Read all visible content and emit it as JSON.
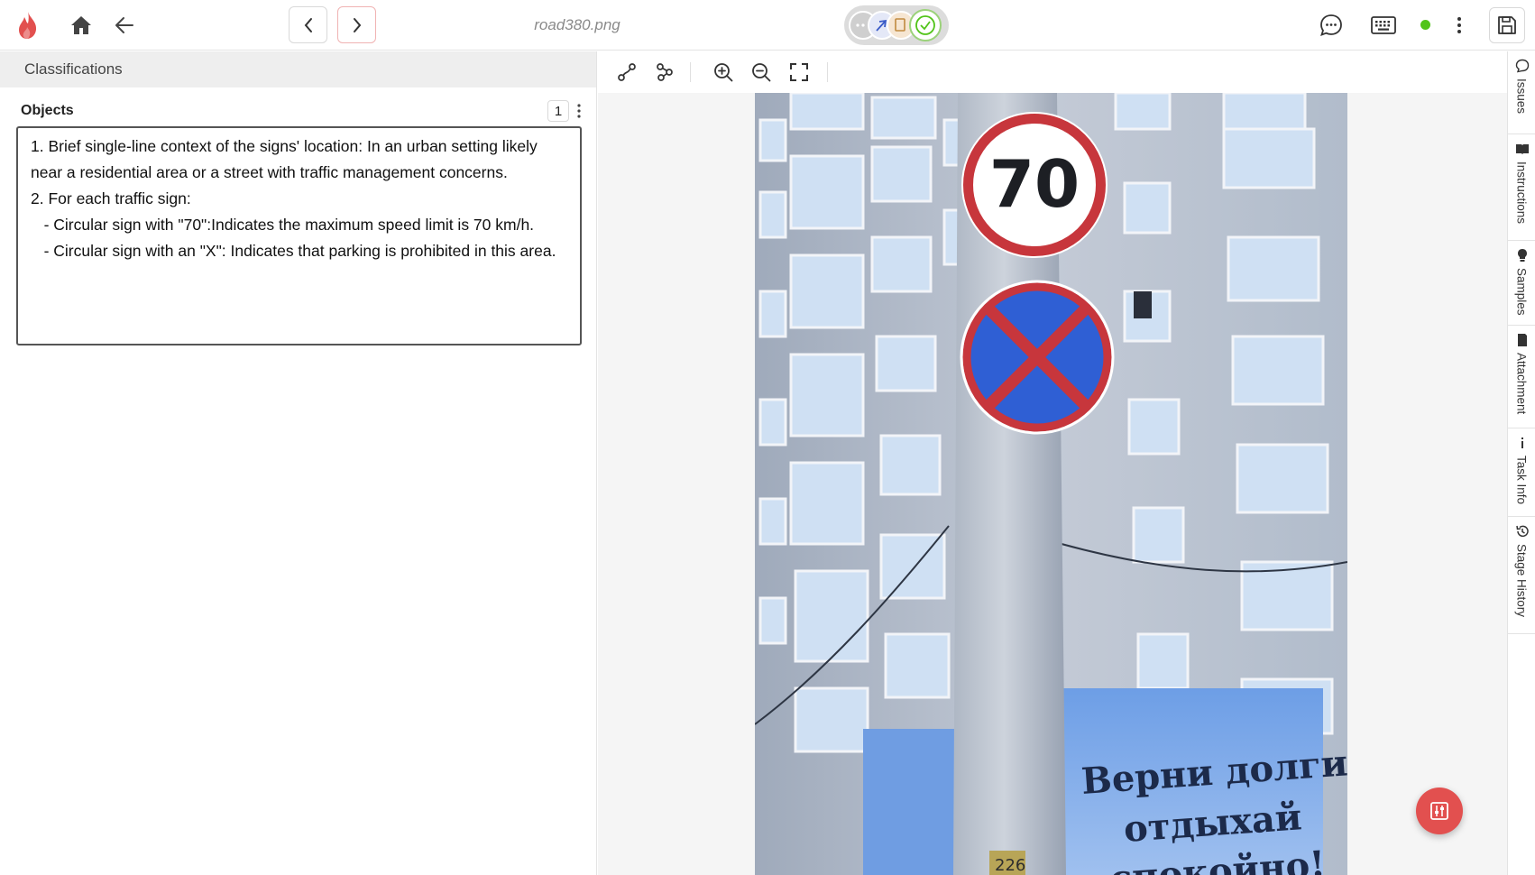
{
  "app": {
    "filename": "road380.png"
  },
  "left_panel": {
    "header": "Classifications",
    "objects_title": "Objects",
    "objects_count": "1",
    "answer_text": "1. Brief single-line context of the signs' location: In an urban setting likely near a residential area or a street with traffic management concerns.\n2. For each traffic sign:\n   - Circular sign with \"70\":Indicates the maximum speed limit is 70 km/h.\n   - Circular sign with an \"X\": Indicates that parking is prohibited in this area."
  },
  "side_tabs": [
    "Issues",
    "Instructions",
    "Samples",
    "Attachment",
    "Task Info",
    "Stage History"
  ],
  "image_text": {
    "speed_sign": "70",
    "billboard_line1": "Верни долги-",
    "billboard_line2": "отдыхай",
    "billboard_line3": "спокойно!",
    "pole_number": "226"
  },
  "colors": {
    "brand": "#e2504f",
    "status_online": "#52c41a",
    "sign_blue": "#2f5fd4",
    "sign_red": "#c7363c"
  },
  "icons": {
    "logo": "flame-icon",
    "home": "home-icon",
    "back": "arrow-left-icon",
    "prev": "chevron-left-icon",
    "next": "chevron-right-icon",
    "chat": "chat-icon",
    "keyboard": "keyboard-icon",
    "menu": "more-vertical-icon",
    "save": "save-icon"
  }
}
